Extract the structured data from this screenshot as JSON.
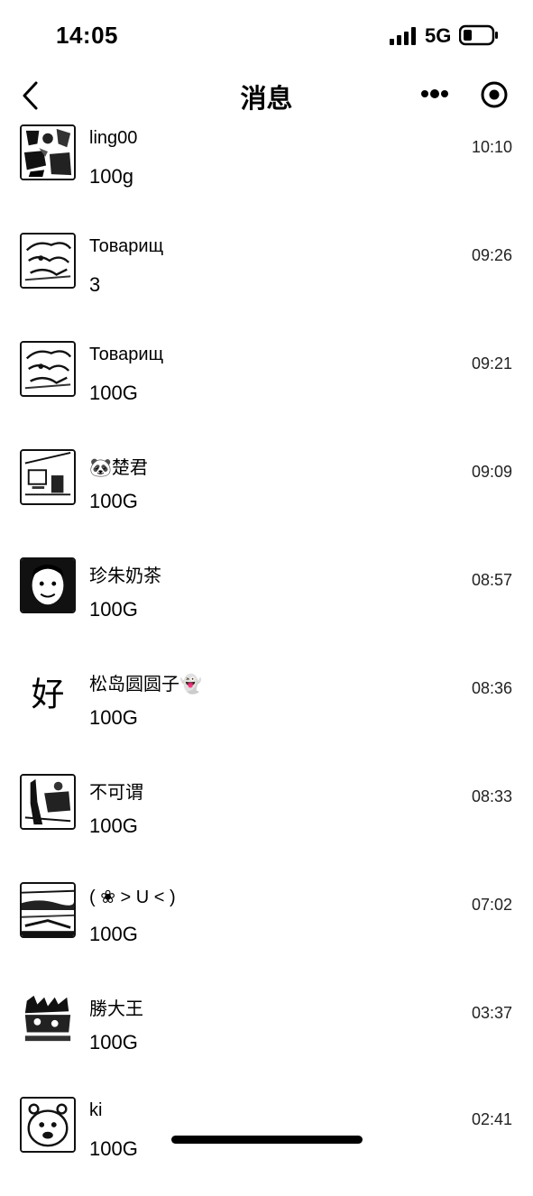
{
  "status_bar": {
    "time": "14:05",
    "network": "5G",
    "icons": [
      "signal-icon",
      "battery-icon"
    ]
  },
  "nav": {
    "title": "消息",
    "icons": [
      "back-icon",
      "more-icon",
      "record-icon"
    ]
  },
  "messages": [
    {
      "name": "ling00",
      "preview": "100g",
      "time": "10:10",
      "avatar": "collage-avatar"
    },
    {
      "name": "Товарищ",
      "preview": "3",
      "time": "09:26",
      "avatar": "sketch-avatar"
    },
    {
      "name": "Товарищ",
      "preview": "100G",
      "time": "09:21",
      "avatar": "sketch-avatar"
    },
    {
      "name": "🐼楚君",
      "preview": "100G",
      "time": "09:09",
      "avatar": "room-avatar"
    },
    {
      "name": "珍朱奶茶",
      "preview": "100G",
      "time": "08:57",
      "avatar": "portrait-avatar"
    },
    {
      "name": "松岛圆圆子👻",
      "preview": "100G",
      "time": "08:36",
      "avatar": "character-avatar",
      "avatar_char": "好"
    },
    {
      "name": "不可谓",
      "preview": "100G",
      "time": "08:33",
      "avatar": "figure-avatar"
    },
    {
      "name": "( ❀ > U < )",
      "preview": "100G",
      "time": "07:02",
      "avatar": "landscape-avatar"
    },
    {
      "name": "勝大王",
      "preview": "100G",
      "time": "03:37",
      "avatar": "crowd-avatar"
    },
    {
      "name": "ki",
      "preview": "100G",
      "time": "02:41",
      "avatar": "face-avatar"
    }
  ]
}
